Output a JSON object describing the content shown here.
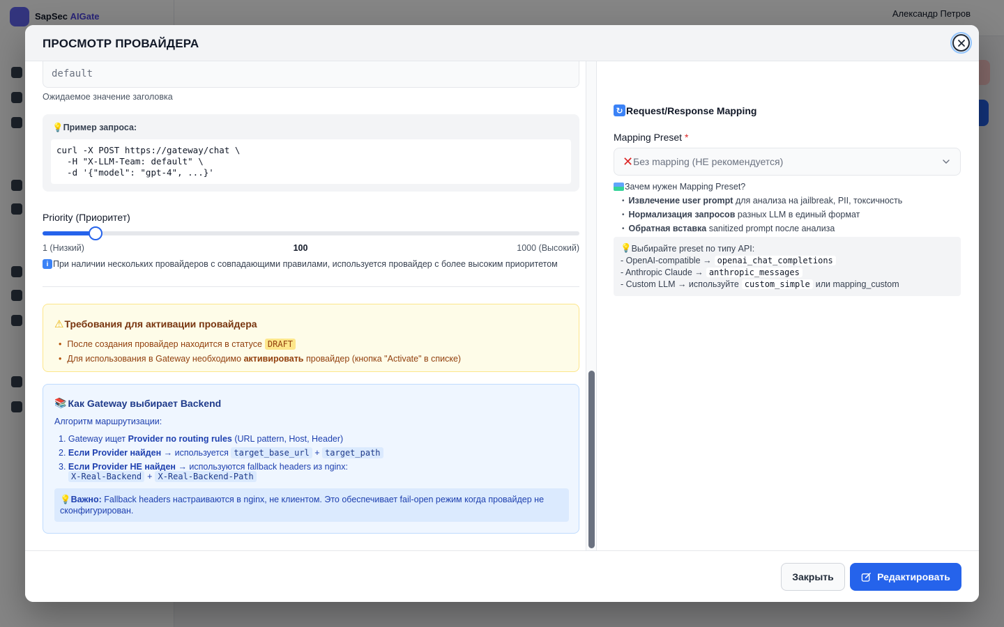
{
  "background": {
    "brand_name": "SapSec",
    "brand_accent": "AIGate",
    "user_name": "Александр Петров"
  },
  "modal": {
    "title": "ПРОСМОТР ПРОВАЙДЕРА",
    "header_value": {
      "value": "default",
      "hint": "Ожидаемое значение заголовка"
    },
    "example": {
      "title": "Пример запроса:",
      "code": "curl -X POST https://gateway/chat \\\n  -H \"X-LLM-Team: default\" \\\n  -d '{\"model\": \"gpt-4\", ...}'"
    },
    "priority": {
      "label": "Priority (Приоритет)",
      "min_label": "1 (Низкий)",
      "max_label": "1000 (Высокий)",
      "value": "100",
      "value_num": 100,
      "min": 1,
      "max": 1000,
      "info": "При наличии нескольких провайдеров с совпадающими правилами, используется провайдер с более высоким приоритетом"
    },
    "warning": {
      "title": "Требования для активации провайдера",
      "item1_text": "После создания провайдер находится в статусе",
      "item1_badge": "DRAFT",
      "item2_pre": "Для использования в Gateway необходимо",
      "item2_bold": "активировать",
      "item2_post": "провайдер (кнопка \"Activate\" в списке)"
    },
    "routing": {
      "title": "Как Gateway выбирает Backend",
      "algo_label": "Алгоритм маршрутизации:",
      "step1_num": "1.",
      "step1_pre": "Gateway ищет",
      "step1_bold": "Provider по routing rules",
      "step1_post": "(URL pattern, Host, Header)",
      "step2_num": "2.",
      "step2_bold": "Если Provider найден",
      "step2_mid": "→ используется",
      "step2_code1": "target_base_url",
      "step2_plus": "+",
      "step2_code2": "target_path",
      "step3_num": "3.",
      "step3_bold": "Если Provider НЕ найден",
      "step3_post": "→ используются fallback headers из nginx:",
      "step3_code1": "X-Real-Backend",
      "step3_plus": "+",
      "step3_code2": "X-Real-Backend-Path",
      "important_bold": "Важно:",
      "important_text": "Fallback headers настраиваются в nginx, не клиентом. Это обеспечивает fail-open режим когда провайдер не сконфигурирован."
    },
    "mapping": {
      "title": "Request/Response Mapping",
      "preset_label": "Mapping Preset",
      "required_mark": "*",
      "preset_value": "Без mapping (НЕ рекомендуется)",
      "why_title": "Зачем нужен Mapping Preset?",
      "why1_bold": "Извлечение user prompt",
      "why1_text": "для анализа на jailbreak, PII, токсичность",
      "why2_bold": "Нормализация запросов",
      "why2_text": "разных LLM в единый формат",
      "why3_bold": "Обратная вставка",
      "why3_text": "sanitized prompt после анализа",
      "tip_title": "Выбирайте preset по типу API:",
      "tip1_text": "- OpenAI-compatible →",
      "tip1_code": "openai_chat_completions",
      "tip2_text": "- Anthropic Claude →",
      "tip2_code": "anthropic_messages",
      "tip3_text": "- Custom LLM → используйте",
      "tip3_code": "custom_simple",
      "tip3_post": "или mapping_custom"
    },
    "footer": {
      "close_label": "Закрыть",
      "edit_label": "Редактировать"
    }
  },
  "colors": {
    "primary": "#2563eb",
    "warning_bg": "#fefce8",
    "info_bg": "#eff6ff"
  },
  "icons": {
    "bulb": "lightbulb-icon",
    "info": "info-icon",
    "warning": "warning-icon",
    "books": "books-icon",
    "refresh": "refresh-icon",
    "cross": "cross-mark-icon",
    "map": "map-icon",
    "close": "close-icon",
    "edit": "edit-icon"
  }
}
